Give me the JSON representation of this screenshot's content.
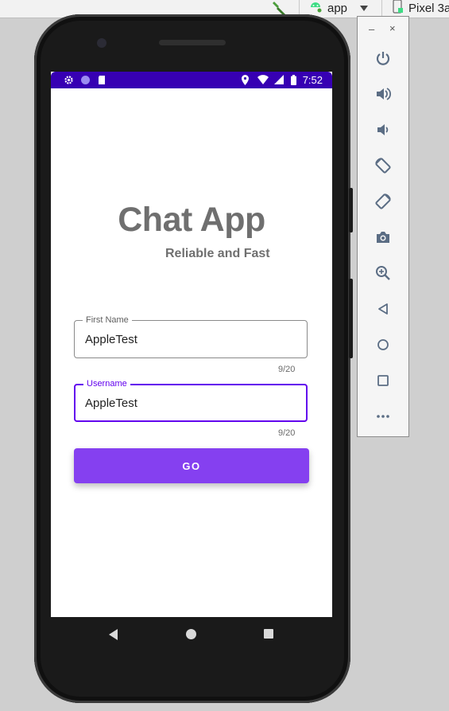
{
  "ide_toolbar": {
    "run_config": "app",
    "device": "Pixel 3a"
  },
  "status_bar": {
    "time": "7:52"
  },
  "app": {
    "title": "Chat App",
    "subtitle": "Reliable and Fast",
    "first_name": {
      "label": "First Name",
      "value": "AppleTest",
      "counter": "9/20"
    },
    "username": {
      "label": "Username",
      "value": "AppleTest",
      "counter": "9/20"
    },
    "go_label": "GO"
  },
  "emulator_panel": {
    "minimize": "–",
    "close": "×",
    "buttons": [
      "power-icon",
      "volume-up-icon",
      "volume-down-icon",
      "rotate-left-icon",
      "rotate-right-icon",
      "camera-icon",
      "zoom-icon",
      "back-icon",
      "home-icon",
      "overview-icon",
      "more-icon"
    ]
  },
  "colors": {
    "status_bar": "#3700b3",
    "accent": "#6200ee",
    "button": "#8540f0",
    "title_text": "#6f6f6f"
  }
}
